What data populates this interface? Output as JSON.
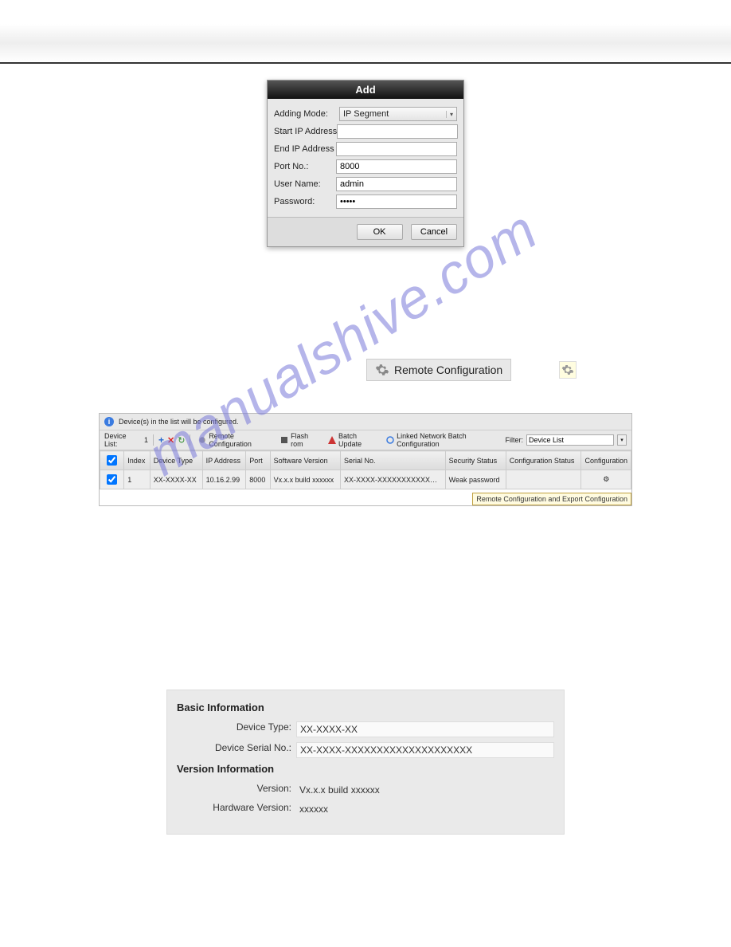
{
  "watermark": "manualshive.com",
  "addDialog": {
    "title": "Add",
    "fields": {
      "addingModeLabel": "Adding Mode:",
      "addingModeValue": "IP Segment",
      "startIpLabel": "Start IP Address",
      "startIpValue": "",
      "endIpLabel": "End IP Address",
      "endIpValue": "",
      "portLabel": "Port No.:",
      "portValue": "8000",
      "userLabel": "User Name:",
      "userValue": "admin",
      "passwordLabel": "Password:",
      "passwordValue": "•••••"
    },
    "okLabel": "OK",
    "cancelLabel": "Cancel"
  },
  "remoteConfigButtonLabel": "Remote Configuration",
  "deviceList": {
    "infoText": "Device(s) in the list will be configured.",
    "toolbar": {
      "listLabel": "Device List:",
      "listCount": "1",
      "remoteConfig": "Remote Configuration",
      "flashRom": "Flash rom",
      "batchUpdate": "Batch Update",
      "linkedBatch": "Linked Network Batch Configuration",
      "filterLabel": "Filter:",
      "filterValue": "Device List"
    },
    "columns": [
      "Index",
      "Device Type",
      "IP Address",
      "Port",
      "Software Version",
      "Serial No.",
      "Security Status",
      "Configuration Status",
      "Configuration"
    ],
    "rows": [
      {
        "index": "1",
        "deviceType": "XX-XXXX-XX",
        "ip": "10.16.2.99",
        "port": "8000",
        "software": "Vx.x.x build xxxxxx",
        "serial": "XX-XXXX-XXXXXXXXXXX…",
        "security": "Weak password",
        "status": "",
        "cfg": "⚙"
      }
    ],
    "tooltip": "Remote Configuration and Export Configuration"
  },
  "infoPanel": {
    "basicTitle": "Basic Information",
    "versionTitle": "Version Information",
    "fields": {
      "deviceTypeLabel": "Device Type:",
      "deviceTypeValue": "XX-XXXX-XX",
      "serialLabel": "Device Serial No.:",
      "serialValue": "XX-XXXX-XXXXXXXXXXXXXXXXXXXX",
      "versionLabel": "Version:",
      "versionValue": "Vx.x.x build xxxxxx",
      "hwLabel": "Hardware Version:",
      "hwValue": "xxxxxx"
    }
  }
}
